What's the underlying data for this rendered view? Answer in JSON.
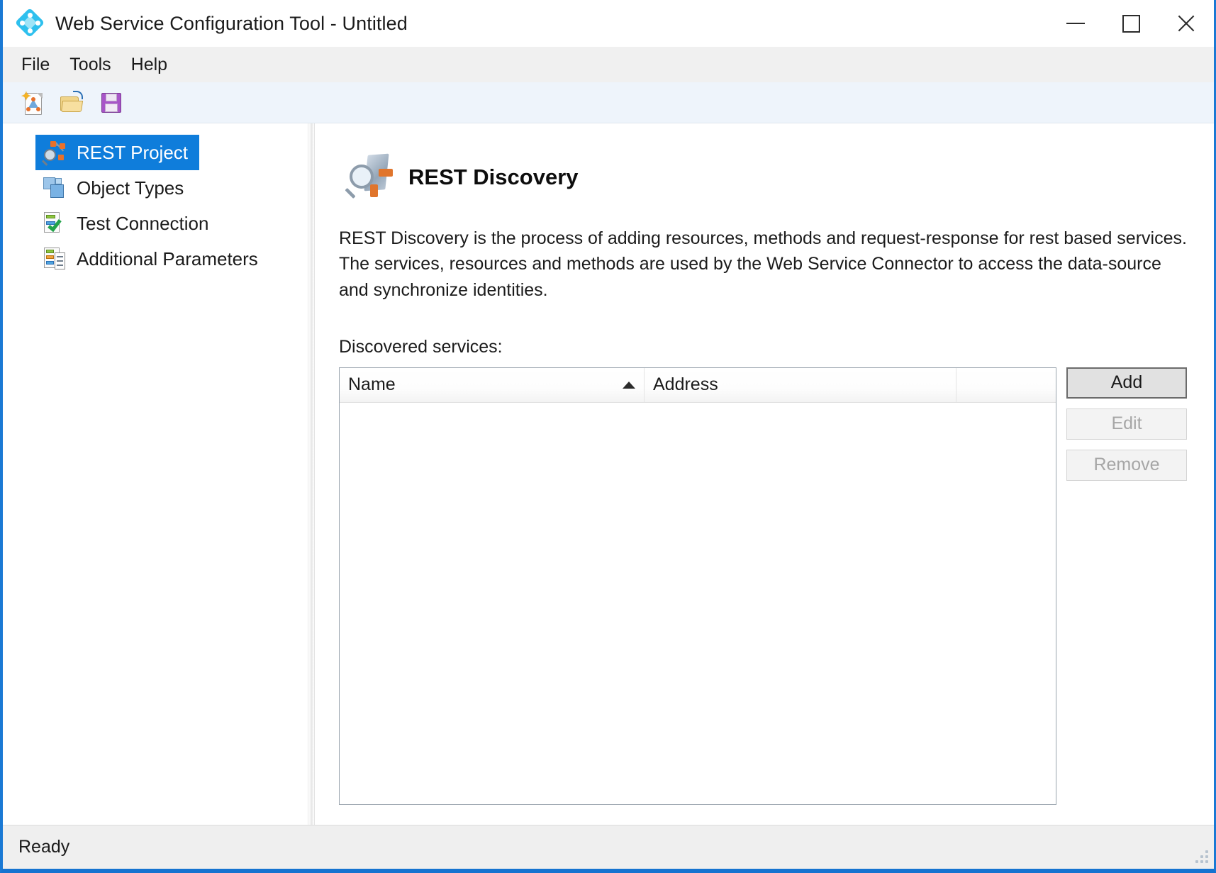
{
  "window": {
    "title": "Web Service Configuration Tool - Untitled",
    "app_icon": "diamond-logo-icon",
    "controls": {
      "minimize": "minimize-icon",
      "maximize": "maximize-icon",
      "close": "close-icon"
    }
  },
  "menubar": {
    "items": [
      {
        "label": "File"
      },
      {
        "label": "Tools"
      },
      {
        "label": "Help"
      }
    ]
  },
  "toolbar": {
    "buttons": [
      {
        "name": "new-project-button",
        "icon": "new-document-icon",
        "tooltip": "New"
      },
      {
        "name": "open-project-button",
        "icon": "open-folder-icon",
        "tooltip": "Open"
      },
      {
        "name": "save-project-button",
        "icon": "save-floppy-icon",
        "tooltip": "Save"
      }
    ]
  },
  "sidebar": {
    "items": [
      {
        "label": "REST Project",
        "icon": "rest-project-icon",
        "selected": true
      },
      {
        "label": "Object Types",
        "icon": "object-types-icon",
        "selected": false
      },
      {
        "label": "Test Connection",
        "icon": "test-connection-icon",
        "selected": false
      },
      {
        "label": "Additional Parameters",
        "icon": "additional-parameters-icon",
        "selected": false
      }
    ],
    "selection_color": "#0f7ddb"
  },
  "content": {
    "page_icon": "rest-discovery-icon",
    "page_title": "REST Discovery",
    "description": "REST Discovery is the process of adding resources, methods and request-response for rest based services. The services, resources and methods are used by the Web Service Connector to access the data-source and synchronize identities.",
    "list_label": "Discovered services:",
    "listview": {
      "columns": [
        {
          "header": "Name",
          "sorted": true,
          "sort_direction": "ascending"
        },
        {
          "header": "Address",
          "sorted": false,
          "sort_direction": ""
        },
        {
          "header": "",
          "sorted": false,
          "sort_direction": ""
        }
      ],
      "rows": [],
      "empty": true
    },
    "buttons": [
      {
        "label": "Add",
        "state": "default-focused"
      },
      {
        "label": "Edit",
        "state": "disabled"
      },
      {
        "label": "Remove",
        "state": "disabled"
      }
    ]
  },
  "statusbar": {
    "text": "Ready",
    "grip": "resize-grip-icon"
  }
}
